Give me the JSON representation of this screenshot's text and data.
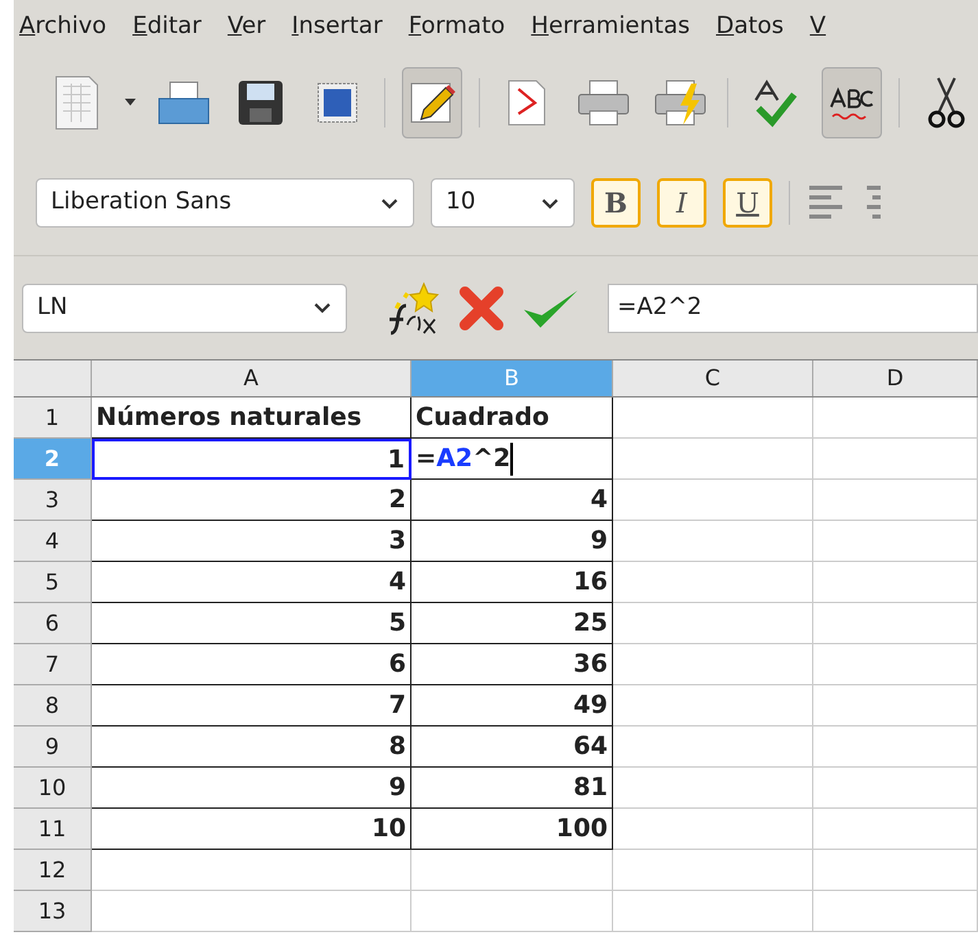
{
  "menu": [
    "Archivo",
    "Editar",
    "Ver",
    "Insertar",
    "Formato",
    "Herramientas",
    "Datos",
    "V"
  ],
  "toolbar": [
    {
      "kind": "new",
      "pressed": false
    },
    {
      "kind": "dropdown",
      "pressed": false
    },
    {
      "kind": "open",
      "pressed": false
    },
    {
      "kind": "save",
      "pressed": false
    },
    {
      "kind": "stamp",
      "pressed": false
    },
    {
      "kind": "sep"
    },
    {
      "kind": "edit",
      "pressed": true
    },
    {
      "kind": "sep"
    },
    {
      "kind": "pdf",
      "pressed": false
    },
    {
      "kind": "print",
      "pressed": false
    },
    {
      "kind": "printdirect",
      "pressed": false
    },
    {
      "kind": "sep"
    },
    {
      "kind": "spell",
      "pressed": false
    },
    {
      "kind": "autospell",
      "pressed": true
    },
    {
      "kind": "sep"
    },
    {
      "kind": "cut",
      "pressed": false
    }
  ],
  "format_bar": {
    "font": "Liberation Sans",
    "size": "10",
    "buttons": [
      {
        "kind": "bold",
        "label": "B"
      },
      {
        "kind": "italic",
        "label": "I"
      },
      {
        "kind": "underline",
        "label": "U"
      }
    ]
  },
  "formula_bar": {
    "name_box": "LN",
    "formula": "=A2^2"
  },
  "columns": [
    {
      "label": "A",
      "selected": false
    },
    {
      "label": "B",
      "selected": true
    },
    {
      "label": "C",
      "selected": false
    },
    {
      "label": "D",
      "selected": false
    }
  ],
  "rows": [
    {
      "header": "1",
      "selected": false,
      "bordered": true,
      "cells": [
        {
          "kind": "text",
          "text": "Números naturales"
        },
        {
          "kind": "text",
          "text": "Cuadrado"
        }
      ]
    },
    {
      "header": "2",
      "selected": true,
      "bordered": true,
      "cells": [
        {
          "kind": "number",
          "text": "1",
          "highlighted": true
        },
        {
          "kind": "edit",
          "parts": [
            {
              "kind": "plain",
              "text": "="
            },
            {
              "kind": "ref",
              "text": "A2"
            },
            {
              "kind": "plain",
              "text": "^2"
            }
          ]
        }
      ]
    },
    {
      "header": "3",
      "selected": false,
      "bordered": true,
      "cells": [
        {
          "kind": "number",
          "text": "2"
        },
        {
          "kind": "number",
          "text": "4"
        }
      ]
    },
    {
      "header": "4",
      "selected": false,
      "bordered": true,
      "cells": [
        {
          "kind": "number",
          "text": "3"
        },
        {
          "kind": "number",
          "text": "9"
        }
      ]
    },
    {
      "header": "5",
      "selected": false,
      "bordered": true,
      "cells": [
        {
          "kind": "number",
          "text": "4"
        },
        {
          "kind": "number",
          "text": "16"
        }
      ]
    },
    {
      "header": "6",
      "selected": false,
      "bordered": true,
      "cells": [
        {
          "kind": "number",
          "text": "5"
        },
        {
          "kind": "number",
          "text": "25"
        }
      ]
    },
    {
      "header": "7",
      "selected": false,
      "bordered": true,
      "cells": [
        {
          "kind": "number",
          "text": "6"
        },
        {
          "kind": "number",
          "text": "36"
        }
      ]
    },
    {
      "header": "8",
      "selected": false,
      "bordered": true,
      "cells": [
        {
          "kind": "number",
          "text": "7"
        },
        {
          "kind": "number",
          "text": "49"
        }
      ]
    },
    {
      "header": "9",
      "selected": false,
      "bordered": true,
      "cells": [
        {
          "kind": "number",
          "text": "8"
        },
        {
          "kind": "number",
          "text": "64"
        }
      ]
    },
    {
      "header": "10",
      "selected": false,
      "bordered": true,
      "cells": [
        {
          "kind": "number",
          "text": "9"
        },
        {
          "kind": "number",
          "text": "81"
        }
      ]
    },
    {
      "header": "11",
      "selected": false,
      "bordered": true,
      "cells": [
        {
          "kind": "number",
          "text": "10"
        },
        {
          "kind": "number",
          "text": "100"
        }
      ]
    },
    {
      "header": "12",
      "selected": false,
      "bordered": false
    },
    {
      "header": "13",
      "selected": false,
      "bordered": false
    }
  ]
}
